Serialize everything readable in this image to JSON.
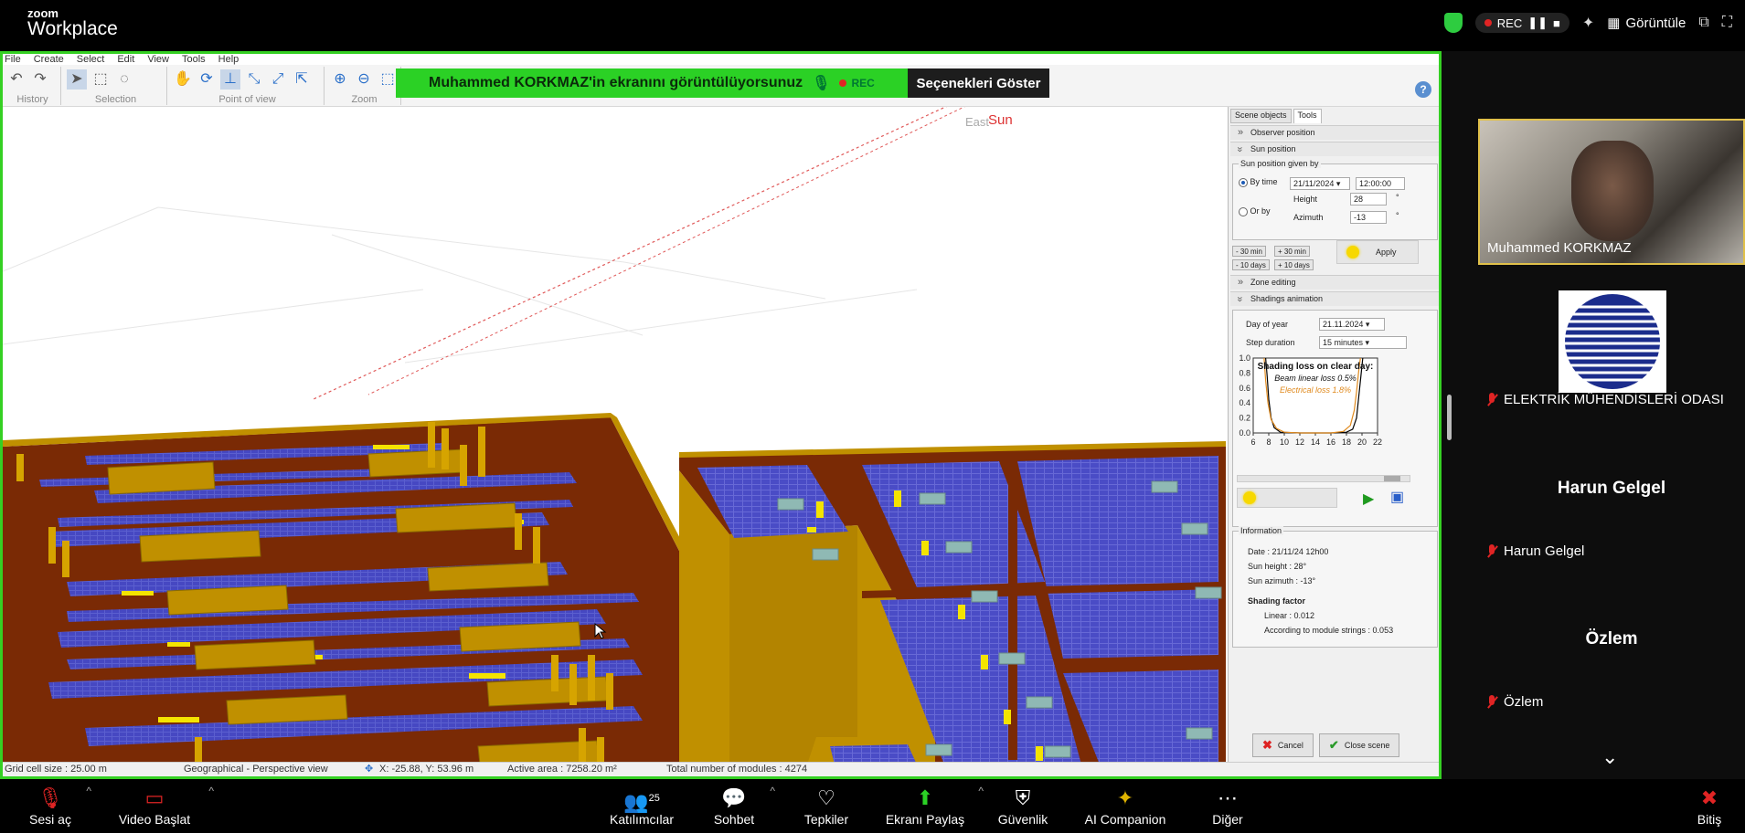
{
  "zoom": {
    "brand_small": "zoom",
    "brand_large": "Workplace",
    "rec_label": "REC",
    "view_label": "Görüntüle"
  },
  "share_banner": {
    "text": "Muhammed KORKMAZ'in ekranını görüntülüyorsunuz",
    "rec_label": "REC",
    "options_label": "Seçenekleri Göster"
  },
  "app": {
    "menu": [
      "File",
      "Create",
      "Select",
      "Edit",
      "View",
      "Tools",
      "Help"
    ],
    "toolbar_groups": [
      "History",
      "Selection",
      "Point of view",
      "Zoom"
    ],
    "help_label": "?"
  },
  "viewport": {
    "east_label": "East",
    "sun_label": "Sun"
  },
  "panel": {
    "tabs": [
      "Scene objects",
      "Tools"
    ],
    "observer_position": "Observer position",
    "sun_position": "Sun position",
    "sun_position_given_by": "Sun position given by",
    "by_time_label": "By time",
    "date_value": "21/11/2024",
    "time_value": "12:00:00",
    "or_by_label": "Or by",
    "height_label": "Height",
    "height_value": "28",
    "azimuth_label": "Azimuth",
    "azimuth_value": "-13",
    "deg": "°",
    "minus_30": "- 30 min",
    "plus_30": "+ 30 min",
    "minus_10d": "- 10 days",
    "plus_10d": "+ 10 days",
    "apply_label": "Apply",
    "zone_editing": "Zone editing",
    "shadings_animation": "Shadings animation",
    "day_of_year_label": "Day of year",
    "day_of_year_value": "21.11.2024",
    "step_duration_label": "Step duration",
    "step_duration_value": "15 minutes",
    "information_label": "Information",
    "info_date": "Date : 21/11/24 12h00",
    "info_sun_height": "Sun height : 28°",
    "info_sun_azimuth": "Sun azimuth : -13°",
    "shading_factor_label": "Shading factor",
    "linear_value": "Linear : 0.012",
    "module_strings_value": "According to module strings : 0.053",
    "cancel_label": "Cancel",
    "close_scene_label": "Close scene"
  },
  "chart_data": {
    "type": "line",
    "title": "Shading loss on clear day:",
    "annotations": [
      "Beam linear loss 0.5%",
      "Electrical loss 1.8%"
    ],
    "x_ticks": [
      "6",
      "8",
      "10",
      "12",
      "14",
      "16",
      "18",
      "20",
      "22"
    ],
    "y_ticks": [
      "0.0",
      "0.2",
      "0.4",
      "0.6",
      "0.8",
      "1.0"
    ],
    "xlim": [
      6,
      22
    ],
    "ylim": [
      0,
      1
    ],
    "series": [
      {
        "name": "Beam linear loss 0.5%",
        "color": "#000000",
        "x": [
          7.6,
          7.8,
          8.0,
          8.3,
          8.7,
          9.5,
          12,
          16,
          18,
          18.8,
          19.3,
          19.6,
          19.9,
          20.1
        ],
        "y": [
          1.0,
          0.75,
          0.45,
          0.2,
          0.07,
          0.01,
          0.0,
          0.0,
          0.01,
          0.05,
          0.2,
          0.5,
          0.8,
          1.0
        ]
      },
      {
        "name": "Electrical loss 1.8%",
        "color": "#e08a1e",
        "x": [
          7.4,
          7.6,
          7.9,
          8.3,
          9.0,
          10,
          12,
          16,
          17.6,
          18.5,
          19.0,
          19.3,
          19.6,
          19.8
        ],
        "y": [
          1.0,
          0.7,
          0.4,
          0.18,
          0.06,
          0.01,
          0.0,
          0.0,
          0.02,
          0.1,
          0.3,
          0.55,
          0.85,
          1.0
        ]
      }
    ]
  },
  "status": {
    "grid": "Grid cell size : 25.00 m",
    "view": "Geographical - Perspective view",
    "coords": "X: -25.88, Y: 53.96 m",
    "active_area": "Active area : 7258.20 m²",
    "modules": "Total number of modules : 4274"
  },
  "participants": [
    {
      "name": "Muhammed KORKMAZ"
    },
    {
      "name": "ELEKTRİK MÜHENDİSLERİ ODASI"
    },
    {
      "name": "Harun Gelgel",
      "display": "Harun Gelgel"
    },
    {
      "name": "Özlem",
      "display": "Özlem"
    }
  ],
  "controls": {
    "mute": "Sesi aç",
    "video": "Video Başlat",
    "participants": "Katılımcılar",
    "participants_count": "25",
    "chat": "Sohbet",
    "reactions": "Tepkiler",
    "share": "Ekranı Paylaş",
    "security": "Güvenlik",
    "ai": "AI Companion",
    "more": "Diğer",
    "end": "Bitiş"
  }
}
